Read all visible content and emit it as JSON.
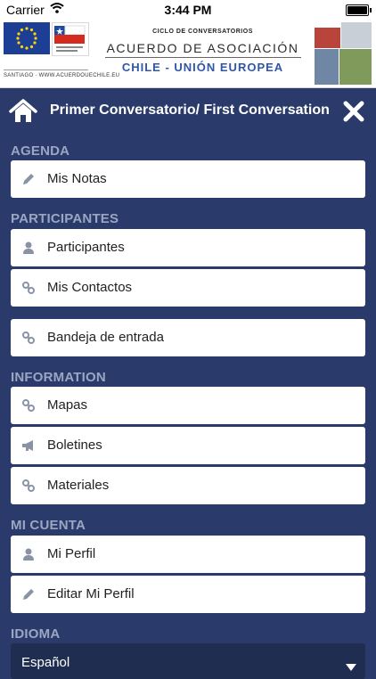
{
  "status_bar": {
    "carrier": "Carrier",
    "time": "3:44 PM"
  },
  "banner": {
    "cycle_text": "CICLO DE CONVERSATORIOS",
    "agreement_text": "ACUERDO DE ASOCIACIÓN",
    "countries_text": "CHILE - UNIÓN EUROPEA",
    "website_text": "SANTIAGO · WWW.ACUERDOUECHILE.EU"
  },
  "header": {
    "title": "Primer Conversatorio/ First Conversation",
    "home_icon": "home-icon",
    "close_icon": "close-icon"
  },
  "sections": {
    "agenda": "AGENDA",
    "participantes": "PARTICIPANTES",
    "information": "INFORMATION",
    "mi_cuenta": "MI CUENTA",
    "idioma": "IDIOMA"
  },
  "items": {
    "mis_notas": {
      "label": "Mis Notas",
      "icon": "pencil-icon"
    },
    "participantes": {
      "label": "Participantes",
      "icon": "person-icon"
    },
    "mis_contactos": {
      "label": "Mis Contactos",
      "icon": "link-icon"
    },
    "bandeja": {
      "label": "Bandeja de entrada",
      "icon": "link-icon"
    },
    "mapas": {
      "label": "Mapas",
      "icon": "link-icon"
    },
    "boletines": {
      "label": "Boletines",
      "icon": "megaphone-icon"
    },
    "materiales": {
      "label": "Materiales",
      "icon": "link-icon"
    },
    "mi_perfil": {
      "label": "Mi Perfil",
      "icon": "person-icon"
    },
    "editar_perfil": {
      "label": "Editar Mi Perfil",
      "icon": "pencil-icon"
    }
  },
  "language_select": {
    "value": "Español"
  },
  "colors": {
    "background": "#2a3b6b",
    "section_text": "#9aa6c2",
    "item_bg": "#ffffff",
    "icon": "#8a93a6"
  }
}
